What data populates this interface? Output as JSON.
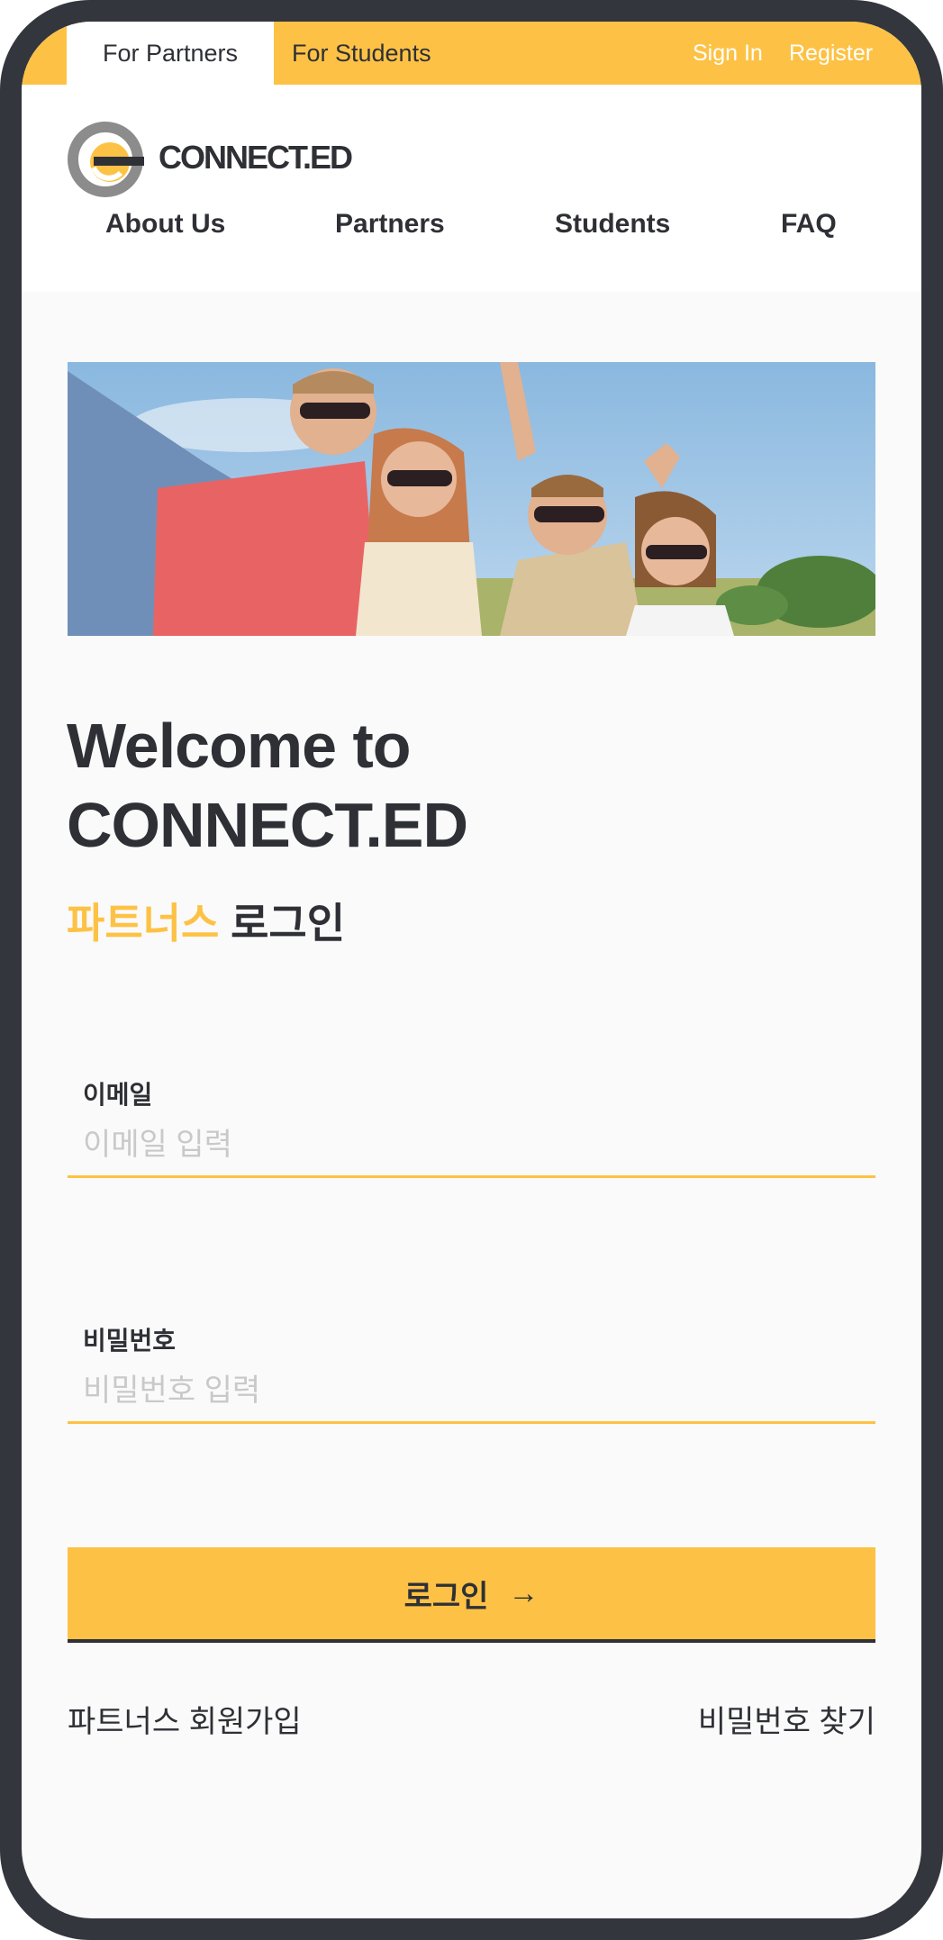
{
  "top_bar": {
    "tab_partners": "For Partners",
    "tab_students": "For Students",
    "sign_in": "Sign In",
    "register": "Register"
  },
  "brand": {
    "logo_text": "CONNECT.ED",
    "accent_color": "#fdc245",
    "dark_color": "#2f3036"
  },
  "nav": {
    "items": [
      "About Us",
      "Partners",
      "Students",
      "FAQ"
    ]
  },
  "hero": {
    "image_icon": "group-photo"
  },
  "main": {
    "title_line1": "Welcome to",
    "title_line2": "CONNECT.ED",
    "subtitle_accent": "파트너스",
    "subtitle_rest": "로그인"
  },
  "form": {
    "email_label": "이메일",
    "email_placeholder": "이메일 입력",
    "email_value": "",
    "password_label": "비밀번호",
    "password_placeholder": "비밀번호 입력",
    "password_value": "",
    "login_label": "로그인",
    "login_icon": "arrow-right-icon"
  },
  "links": {
    "signup": "파트너스 회원가입",
    "find_password": "비밀번호 찾기"
  }
}
